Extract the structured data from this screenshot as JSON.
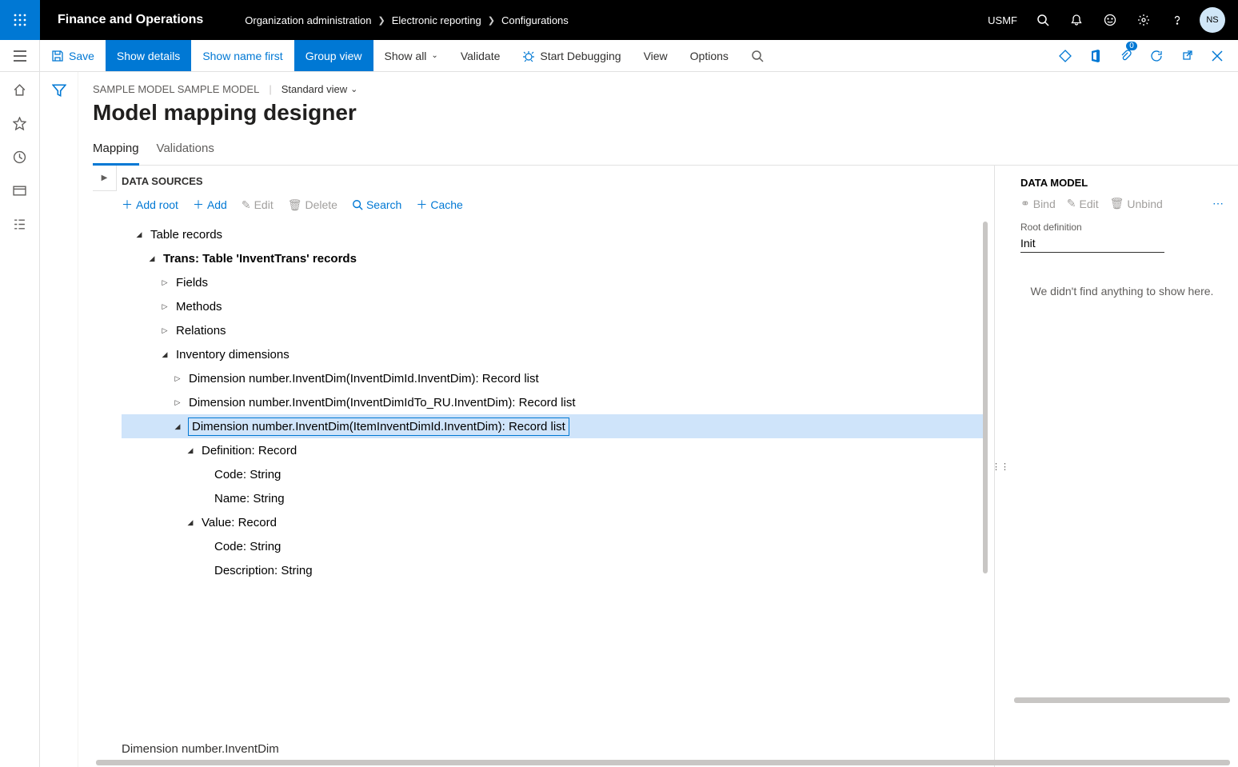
{
  "topbar": {
    "app_title": "Finance and Operations",
    "breadcrumbs": [
      "Organization administration",
      "Electronic reporting",
      "Configurations"
    ],
    "entity": "USMF",
    "avatar": "NS"
  },
  "actionbar": {
    "save": "Save",
    "show_details": "Show details",
    "show_name_first": "Show name first",
    "group_view": "Group view",
    "show_all": "Show all",
    "validate": "Validate",
    "start_debugging": "Start Debugging",
    "view": "View",
    "options": "Options",
    "badge_count": "0"
  },
  "page": {
    "crumb": "SAMPLE MODEL SAMPLE MODEL",
    "standard_view": "Standard view",
    "title": "Model mapping designer",
    "tabs": {
      "mapping": "Mapping",
      "validations": "Validations"
    }
  },
  "datasources": {
    "header": "DATA SOURCES",
    "toolbar": {
      "add_root": "Add root",
      "add": "Add",
      "edit": "Edit",
      "delete": "Delete",
      "search": "Search",
      "cache": "Cache"
    },
    "tree": [
      {
        "indent": 0,
        "twist": "down",
        "label": "Table records",
        "bold": false
      },
      {
        "indent": 1,
        "twist": "down",
        "label": "Trans: Table 'InventTrans' records",
        "bold": true
      },
      {
        "indent": 2,
        "twist": "right",
        "label": "Fields"
      },
      {
        "indent": 2,
        "twist": "right",
        "label": "Methods"
      },
      {
        "indent": 2,
        "twist": "right",
        "label": "Relations"
      },
      {
        "indent": 2,
        "twist": "down",
        "label": "Inventory dimensions"
      },
      {
        "indent": 3,
        "twist": "right",
        "label": "Dimension number.InventDim(InventDimId.InventDim): Record list"
      },
      {
        "indent": 3,
        "twist": "right",
        "label": "Dimension number.InventDim(InventDimIdTo_RU.InventDim): Record list"
      },
      {
        "indent": 3,
        "twist": "down",
        "label": "Dimension number.InventDim(ItemInventDimId.InventDim): Record list",
        "selected": true
      },
      {
        "indent": 4,
        "twist": "down",
        "label": "Definition: Record"
      },
      {
        "indent": 5,
        "twist": "",
        "label": "Code: String"
      },
      {
        "indent": 5,
        "twist": "",
        "label": "Name: String"
      },
      {
        "indent": 4,
        "twist": "down",
        "label": "Value: Record"
      },
      {
        "indent": 5,
        "twist": "",
        "label": "Code: String"
      },
      {
        "indent": 5,
        "twist": "",
        "label": "Description: String"
      }
    ],
    "path": "Dimension number.InventDim"
  },
  "datamodel": {
    "title": "DATA MODEL",
    "bind": "Bind",
    "edit": "Edit",
    "unbind": "Unbind",
    "root_def_label": "Root definition",
    "root_def_value": "Init",
    "empty": "We didn't find anything to show here."
  }
}
